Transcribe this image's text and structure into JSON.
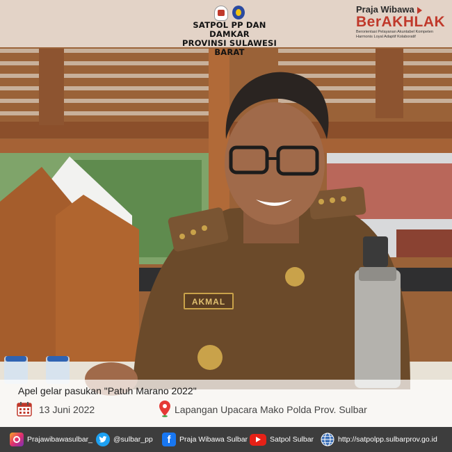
{
  "header": {
    "org_line1": "SATPOL PP DAN DAMKAR",
    "org_line2": "PROVINSI SULAWESI BARAT",
    "brand_top": "Praja Wibawa",
    "brand_main": "BerAKHLAK",
    "brand_tagline_1": "Berorientasi Pelayanan Akuntabel Kompeten",
    "brand_tagline_2": "Harmonis Loyal Adaptif Kolaboratif"
  },
  "caption": {
    "title": "Apel gelar pasukan \"Patuh Marano 2022\"",
    "date": "13 Juni 2022",
    "location": "Lapangan Upacara Mako Polda  Prov. Sulbar"
  },
  "photo": {
    "name_tag": "AKMAL"
  },
  "footer": {
    "items": [
      {
        "icon": "instagram-icon",
        "label": "Prajawibawasulbar_",
        "color": "#c13584"
      },
      {
        "icon": "twitter-icon",
        "label": "@sulbar_pp",
        "color": "#1da1f2"
      },
      {
        "icon": "facebook-icon",
        "label": "Praja Wibawa Sulbar",
        "color": "#1877f2"
      },
      {
        "icon": "youtube-icon",
        "label": "Satpol Sulbar",
        "color": "#e62117"
      },
      {
        "icon": "globe-icon",
        "label": "http://satpolpp.sulbarprov.go.id",
        "color": "#3b6fb6"
      }
    ]
  },
  "colors": {
    "brand_red": "#c0392b",
    "footer_bg": "#3d3d3d",
    "uniform": "#6b4a2a"
  }
}
